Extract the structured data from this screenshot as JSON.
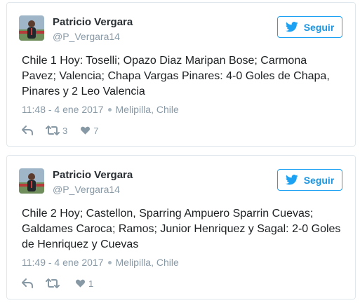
{
  "tweets": [
    {
      "name": "Patricio Vergara",
      "handle": "@P_Vergara14",
      "follow_label": "Seguir",
      "text": "Chile 1 Hoy: Toselli; Opazo Diaz Maripan Bose; Carmona\nPavez; Valencia; Chapa Vargas Pinares: 4-0 Goles de Chapa,\nPinares y 2 Leo Valencia",
      "time": "11:48 - 4 ene 2017",
      "location": "Melipilla, Chile",
      "retweets": "3",
      "likes": "7"
    },
    {
      "name": "Patricio Vergara",
      "handle": "@P_Vergara14",
      "follow_label": "Seguir",
      "text": "Chile 2 Hoy; Castellon, Sparring Ampuero Sparrin Cuevas;\nGaldames Caroca; Ramos; Junior Henriquez y Sagal: 2-0 Goles\nde Henriquez y Cuevas",
      "time": "11:49 - 4 ene 2017",
      "location": "Melipilla, Chile",
      "retweets": "",
      "likes": "1"
    }
  ],
  "icons": {
    "follow": "bird-icon",
    "reply": "reply-icon",
    "retweet": "retweet-icon",
    "like": "heart-icon",
    "location": "location-pin-icon"
  },
  "colors": {
    "accent": "#1da1f2",
    "muted": "#8899a6",
    "border": "#e1e8ed",
    "text": "#1c2022"
  }
}
